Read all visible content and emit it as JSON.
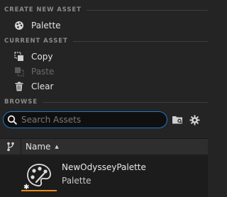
{
  "sections": {
    "create_new_asset": "CREATE NEW ASSET",
    "current_asset": "CURRENT ASSET",
    "browse": "BROWSE"
  },
  "menu": {
    "palette": "Palette",
    "copy": "Copy",
    "paste": "Paste",
    "clear": "Clear"
  },
  "search": {
    "placeholder": "Search Assets",
    "value": ""
  },
  "columns": {
    "name": "Name"
  },
  "assets": [
    {
      "name": "NewOdysseyPalette",
      "type": "Palette"
    }
  ],
  "colors": {
    "accent_blue": "#1e78c8",
    "asset_underline": "#e8891c",
    "background": "#242424"
  }
}
